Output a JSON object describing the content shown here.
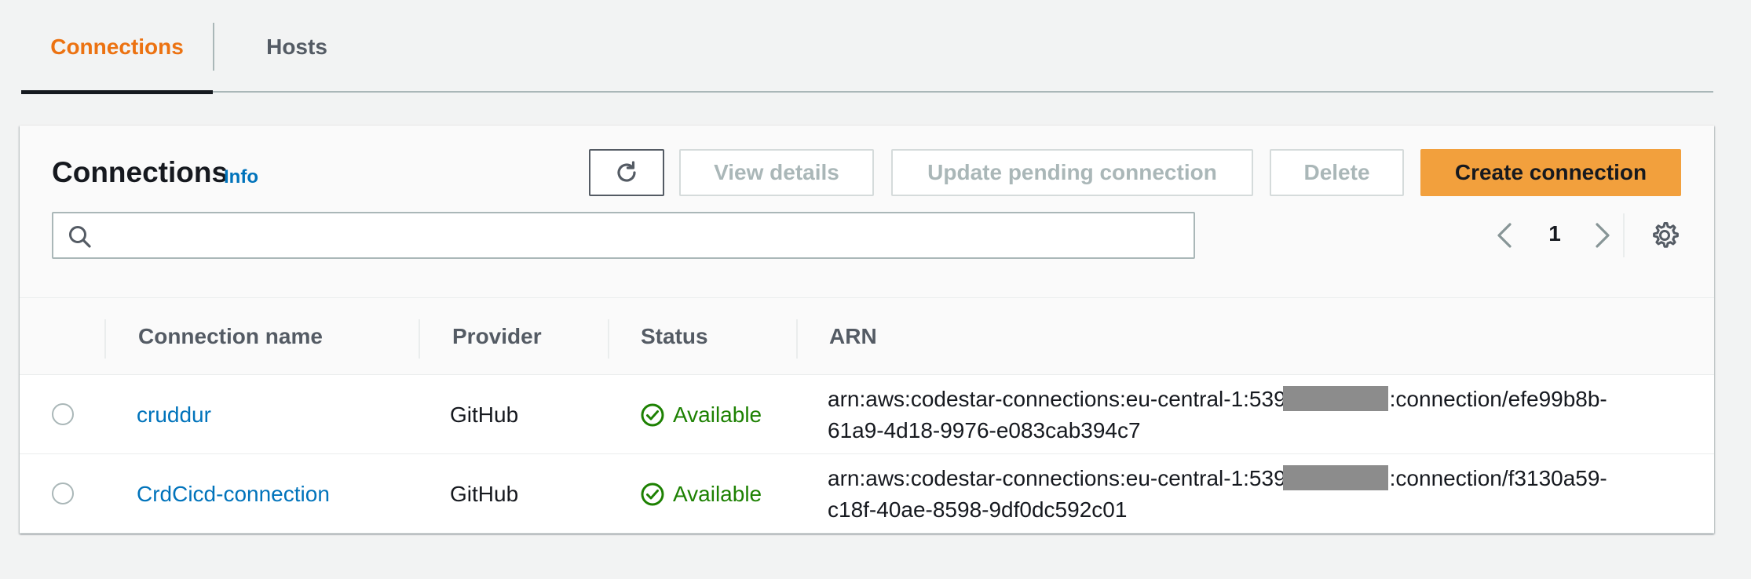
{
  "tabs": [
    {
      "label": "Connections",
      "active": true
    },
    {
      "label": "Hosts",
      "active": false
    }
  ],
  "panel": {
    "title": "Connections",
    "info_label": "Info",
    "buttons": {
      "view_details": "View details",
      "update_pending": "Update pending connection",
      "delete": "Delete",
      "create": "Create connection"
    },
    "search": {
      "value": "",
      "placeholder": ""
    },
    "pagination": {
      "current_page": "1"
    }
  },
  "table": {
    "columns": [
      "Connection name",
      "Provider",
      "Status",
      "ARN"
    ],
    "rows": [
      {
        "name": "cruddur",
        "provider": "GitHub",
        "status": "Available",
        "arn_prefix": "arn:aws:codestar-connections:eu-central-1:539",
        "arn_suffix_line1": ":connection/efe99b8b-",
        "arn_line2": "61a9-4d18-9976-e083cab394c7"
      },
      {
        "name": "CrdCicd-connection",
        "provider": "GitHub",
        "status": "Available",
        "arn_prefix": "arn:aws:codestar-connections:eu-central-1:539",
        "arn_suffix_line1": ":connection/f3130a59-",
        "arn_line2": "c18f-40ae-8598-9df0dc592c01"
      }
    ]
  },
  "colors": {
    "active_tab": "#ec7211",
    "link": "#0073bb",
    "status_available": "#1d8102",
    "primary_button": "#f2a03d"
  },
  "icons": {
    "refresh": "refresh-icon",
    "search": "search-icon",
    "prev": "chevron-left-icon",
    "next": "chevron-right-icon",
    "settings": "gear-icon",
    "status": "check-circle-icon"
  }
}
